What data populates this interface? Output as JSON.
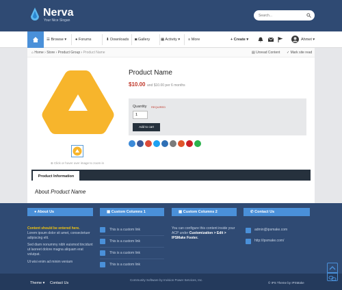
{
  "header": {
    "site_name": "Nerva",
    "site_slogan": "Your Nice Slogan",
    "search_placeholder": "Search..."
  },
  "nav": {
    "items": [
      {
        "label": "Browse ▾"
      },
      {
        "label": "Forums"
      },
      {
        "label": "Downloads"
      },
      {
        "label": "Gallery"
      },
      {
        "label": "Activity ▾"
      },
      {
        "label": "More"
      }
    ],
    "create_label": "Create ▾",
    "user_name": "Ahmet ▾"
  },
  "breadcrumb": {
    "items": [
      "Home",
      "Store",
      "Product Group",
      "Product Name"
    ],
    "unread_label": "Unread Content",
    "mark_read_label": "Mark site read"
  },
  "product": {
    "title": "Product Name",
    "price": "$10.00",
    "price_note": "and $10.00 per 6 months",
    "quantity_label": "Quantity",
    "required_label": "REQUIRED",
    "quantity_value": "1",
    "add_to_cart_label": "Add to cart",
    "zoom_note": "Click or hover over image to zoom in",
    "tab_label": "Product Information",
    "about_prefix": "About",
    "about_name": "Product Name",
    "logo_color": "#f7b52c"
  },
  "share_colors": [
    "#3b8ad8",
    "#3b5998",
    "#dd4b39",
    "#1da1f2",
    "#2e6fb5",
    "#7b7b7b",
    "#e0552b",
    "#cb2027",
    "#2bb24c",
    "#0077b5"
  ],
  "footer": {
    "about_title": "About Us",
    "about_highlight": "Content should be entered here.",
    "about_text1": "Lorem ipsum dolor sit amet, consectetuer adipiscing elit.",
    "about_text2": "Sed diam nonummy nibh euismod tincidunt ut laoreet dolore magna aliquam erat volutpat.",
    "about_text3": "Ut wisi enim ad minim veniam",
    "col1_title": "Custom Columns 1",
    "col1_links": [
      "This is a custom link",
      "This is a custom link",
      "This is a custom link",
      "This is a custom link"
    ],
    "col2_title": "Custom Columns 2",
    "col2_text_pre": "You can configure this content inside your ACP under",
    "col2_text_bold": "Customization > Edit > IPSMake Footer.",
    "contact_title": "Contact Us",
    "contact_email": "admin@ipsmake.com",
    "contact_site": "http://ipsmake.com/",
    "theme_label": "Theme ▾",
    "contact_link": "Contact Us",
    "copyright": "Community Software by Invision Power Services, Inc.",
    "credit_prefix": "IPS Theme",
    "credit_by": "by",
    "credit_name": "IPSMake"
  }
}
